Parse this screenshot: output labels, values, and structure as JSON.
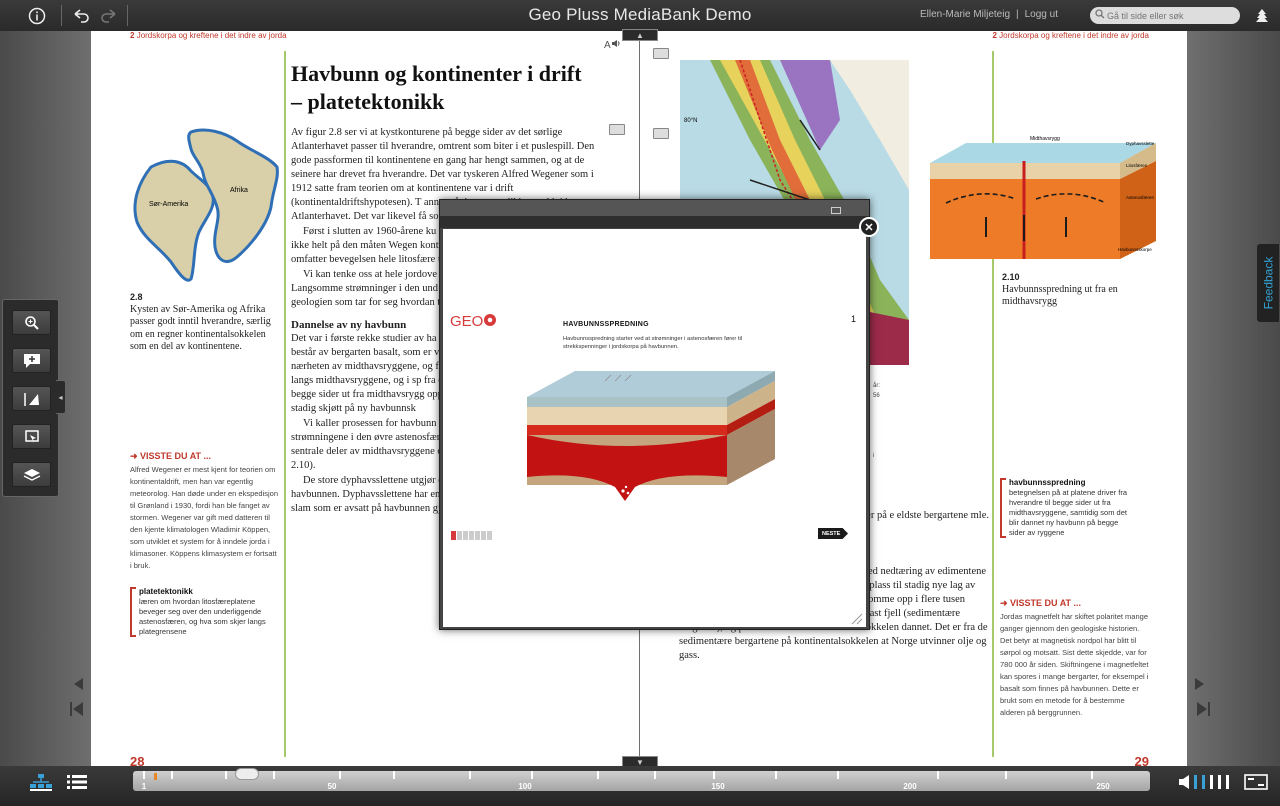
{
  "topbar": {
    "title": "Geo Pluss MediaBank Demo",
    "user": "Ellen-Marie Miljeteig",
    "separator": "|",
    "logout": "Logg ut",
    "search_placeholder": "Gå til side eller søk",
    "icons": [
      "info-icon",
      "undo-icon",
      "redo-icon",
      "search-icon",
      "tree-icon"
    ]
  },
  "left_page": {
    "running_head_num": "2",
    "running_head": "Jordskorpa og kreftene i det indre av jorda",
    "page_number": "28",
    "heading": "Havbunn og kontinenter i drift – platetektonikk",
    "map_labels": {
      "sa": "Sør-Amerika",
      "af": "Afrika"
    },
    "figure_num": "2.8",
    "figure_caption": "Kysten av Sør-Amerika og Afrika passer godt inntil hverandre, særlig om en regner kontinentalsokkelen som en del av kontinentene.",
    "body_p1": "Av figur 2.8 ser vi at kystkonturene på begge sider av det sørlige Atlanterhavet passer til hverandre, omtrent som biter i et puslespill. Den gode passformen til kontinentene en gang har hengt sammen, og at de seinere har drevet fra hverandre. Det var tyskeren Alfred Wegener som i 1912 satte fram teorien om at kontinentene var i drift (kontinentaldriftshypotesen). T annet påvist mange likhetstrekk i b Atlanterhavet. Det var likevel få so hypotese.",
    "body_p2": "Først i slutten av 1960-årene ku ytterste skallet på jordkloden virke det ikke helt på den måten Wegen kontinentene som beveger seg, mo omfatter bevegelsen hele litosfære tynnere jordskorpa.",
    "body_p3": "Vi kan tenke oss at hele jordove litosfæreplater som er i stadig beve Langsomme strømninger i den und til bevegelsen. Platetektonikk er b geologien som tar for seg hvordan toppen av astenosfæren, og hva so",
    "subheading": "Dannelse av ny havbunn",
    "body_p4": "Det var i første rekke studier av ha som nå kalles platetektonikk. Bunn består av bergarten basalt, som er vulkanutbrudd. Det ble påvist at b nærheten av midthavsryggene, og fra ryggene vi kommer (figur 2.9). opp langs midthavsryggene, og i sp fra dypet. Sprekken oppstår fordi l til begge sider ut fra midthavsrygg opp, tetter sprekkene etter hvert so det stadig skjøtt på ny havbunnsk",
    "body_p5": "Vi kaller prosessen for havbunn spredningen er de langsomme strømningene i den øvre astenosfæren. Materialet strømmer opp mot sentrale deler av midthavsryggene og brer seg derfra ut mot sidene (figur 2.10).",
    "body_p6": "De store dyphavsslettene utgjør de litt eldre delene av jordskorpa på havbunnen. Dyphavsslettene har en jevn overflate dekket av finkornet slam som er avsatt på havbunnen gjennom millioner av år.",
    "visste_heading": "➜ VISSTE DU AT ...",
    "visste_text": "Alfred Wegener er mest kjent for teorien om kontinentaldrift, men han var egentlig meteorolog. Han døde under en ekspedisjon til Grønland i 1930, fordi han ble fanget av stormen. Wegener var gift med datteren til den kjente klimatologen Wladimir Köppen, som utviklet et system for å inndele jorda i klimasoner. Köppens klimasystem er fortsatt i bruk.",
    "gloss_term": "platetektonikk",
    "gloss_def": "læren om hvordan litosfæreplatene beveger seg over den underliggende astenosfæren, og hva som skjer langs plategrensene"
  },
  "right_page": {
    "running_head_num": "2",
    "running_head": "Jordskorpa og kreftene i det indre av jorda",
    "page_number": "29",
    "map_label": "80°N",
    "diagram_labels": [
      "Midthavsrygg",
      "Dyphavsslette",
      "Litosfæren",
      "Astenosfæren",
      "Havbunnsskorpe"
    ],
    "figure_num": "2.10",
    "figure_caption": "Havbunnsspredning ut fra en midthavsrygg",
    "partial_caption": [
      "år:",
      "56",
      "i"
    ],
    "body_p1": "mnet bergarter som er ll fra det en finner på e eldste bergartene mle.",
    "body_p2": "nnom lang tid avsatt er isbreer. Sedimentene ed nedtæring av edimentene langs kysten mantelen. På den måten blir det plass til stadig nye lag av sedimenter. Tykkelsen på avsetningene kan komme opp i flere tusen meter. Sedimentene blir med tiden herdet til fast fjell (sedimentære bergarter), og på den måten blir kontinentalsokkelen dannet. Det er fra de sedimentære bergartene på kontinentalsokkelen at Norge utvinner olje og gass.",
    "gloss_term": "havbunnsspredning",
    "gloss_def": "betegnelsen på at platene driver fra hverandre til begge sider ut fra midthavsryggene, samtidig som det blir dannet ny havbunn på begge sider av ryggene",
    "visste_heading": "➜ VISSTE DU AT ...",
    "visste_text": "Jordas magnetfelt har skiftet polaritet mange ganger gjennom den geologiske historien. Det betyr at magnetisk nordpol har blitt til sørpol og motsatt. Sist dette skjedde, var for 780 000 år siden. Skiftningene i magnetfeltet kan spores i mange bergarter, for eksempel i basalt som finnes på havbunnen. Dette er brukt som en metode for å bestemme alderen på berggrunnen."
  },
  "modal": {
    "logo": "GEO",
    "slide_number": "1",
    "title": "HAVBUNNSSPREDNING",
    "description": "Havbunnsspredning starter ved at strømninger i astenosfæren fører til strekkspenninger i jordskorpa på havbunnen.",
    "next_label": "NESTE",
    "close": "✕",
    "progress_total": 7,
    "progress_current": 1
  },
  "sidebar": {
    "tools": [
      "zoom-icon",
      "add-note-icon",
      "highlight-icon",
      "screen-capture-icon",
      "layers-icon"
    ],
    "collapse": "◂"
  },
  "feedback": "Feedback",
  "bottombar": {
    "timeline_labels": [
      "1",
      "50",
      "100",
      "150",
      "200",
      "250"
    ],
    "timeline_current_page": 28
  }
}
